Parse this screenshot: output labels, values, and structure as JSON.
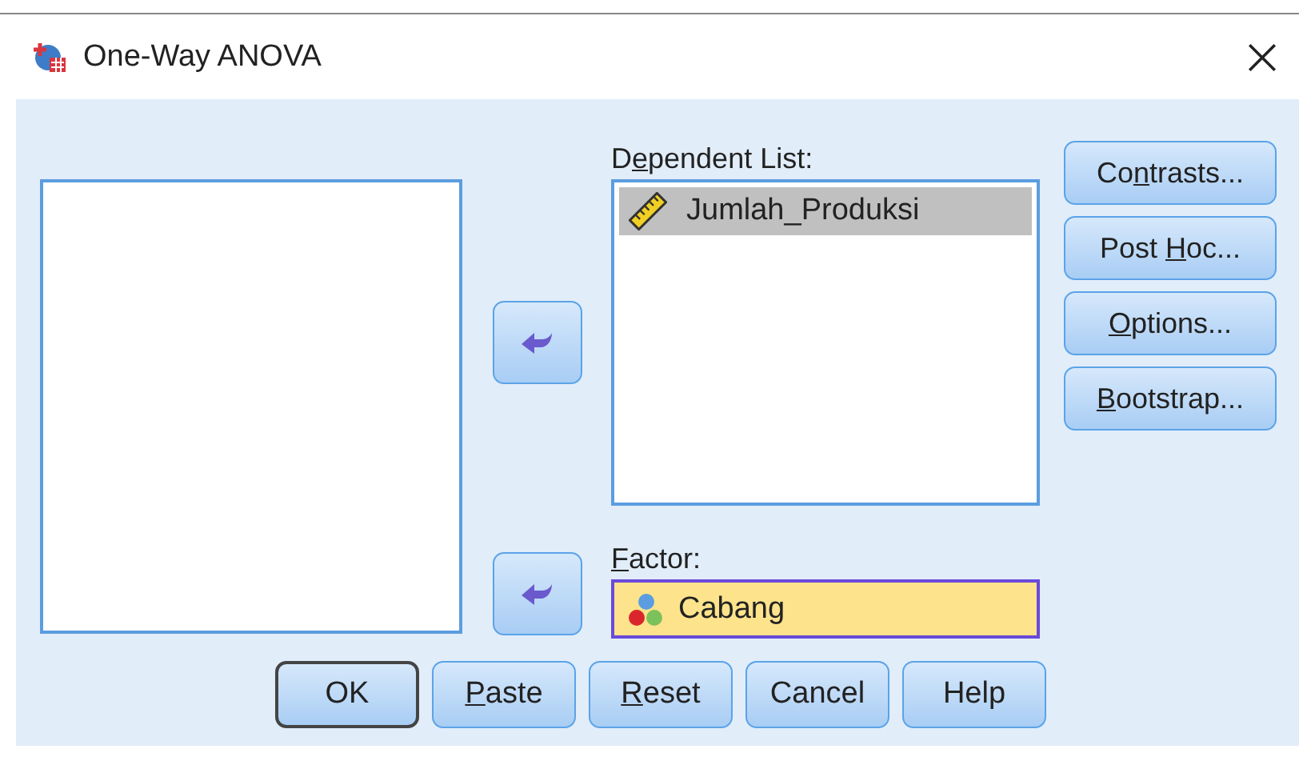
{
  "window": {
    "title": "One-Way ANOVA"
  },
  "dependent_list": {
    "label_before": "D",
    "mnemonic": "e",
    "label_after": "pendent List:",
    "items": [
      {
        "name": "Jumlah_Produksi",
        "kind": "scale",
        "selected": true
      }
    ]
  },
  "factor": {
    "mnemonic": "F",
    "label_after": "actor:",
    "value": "Cabang",
    "kind": "nominal",
    "focused": true
  },
  "side_buttons": [
    {
      "label_before": "Co",
      "mnemonic": "n",
      "label_after": "trasts..."
    },
    {
      "label_before": "Post ",
      "mnemonic": "H",
      "label_after": "oc..."
    },
    {
      "mnemonic": "O",
      "label_after": "ptions..."
    },
    {
      "mnemonic": "B",
      "label_after": "ootstrap..."
    }
  ],
  "buttons": [
    {
      "label": "OK",
      "default": true
    },
    {
      "mnemonic": "P",
      "label_after": "aste",
      "default": false
    },
    {
      "mnemonic": "R",
      "label_after": "eset",
      "default": false
    },
    {
      "label": "Cancel",
      "default": false
    },
    {
      "label": "Help",
      "default": false
    }
  ]
}
